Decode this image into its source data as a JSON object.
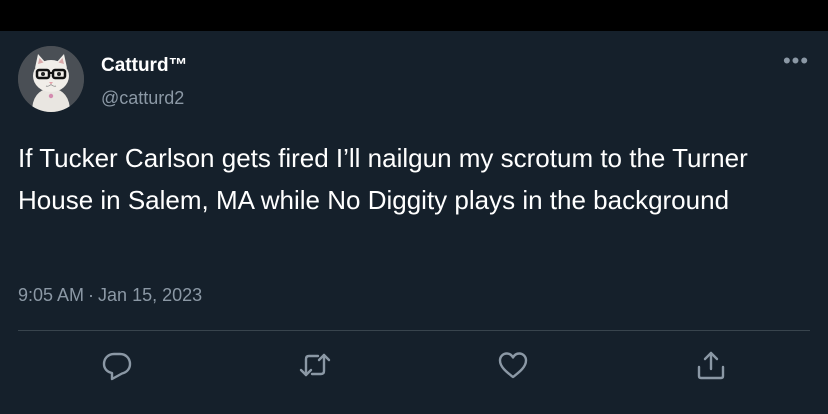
{
  "tweet": {
    "author": {
      "display_name": "Catturd™",
      "handle": "@catturd2",
      "avatar_icon": "cat-with-glasses-avatar"
    },
    "text": "If Tucker Carlson gets fired I’ll nailgun my scrotum to the Turner House in Salem, MA while No Diggity plays in the background",
    "time": "9:05 AM",
    "separator": "·",
    "date": "Jan 15, 2023",
    "more_icon": "more-icon",
    "more_glyph": "•••"
  },
  "actions": [
    {
      "name": "reply",
      "icon": "reply-icon"
    },
    {
      "name": "retweet",
      "icon": "retweet-icon"
    },
    {
      "name": "like",
      "icon": "heart-icon"
    },
    {
      "name": "share",
      "icon": "share-icon"
    }
  ],
  "colors": {
    "background": "#15202b",
    "top_bar": "#000000",
    "primary_text": "#ffffff",
    "secondary_text": "#8b98a5",
    "divider": "#38444d"
  }
}
